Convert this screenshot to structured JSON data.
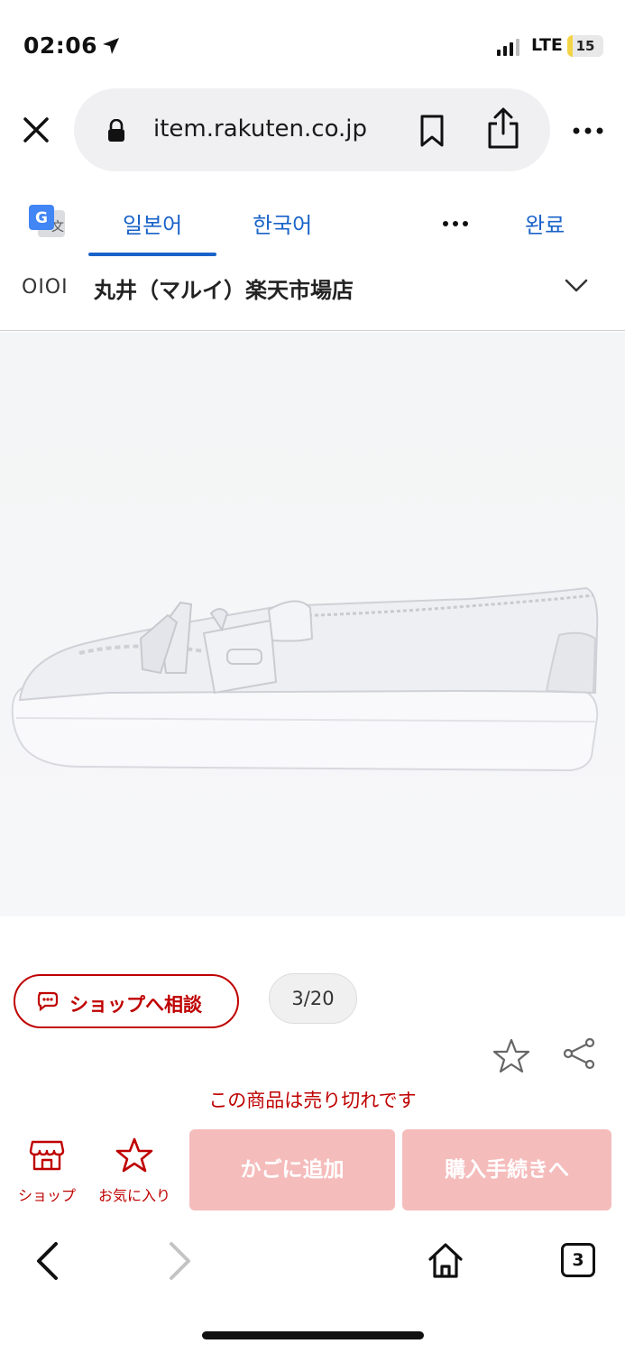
{
  "status_bar": {
    "time": "02:06",
    "network": "LTE",
    "battery": "15",
    "battery_level": 0.15
  },
  "browser": {
    "url": "item.rakuten.co.jp",
    "open_tabs": "3"
  },
  "translate_bar": {
    "tabs": [
      {
        "label": "일본어",
        "active": true
      },
      {
        "label": "한국어",
        "active": false
      }
    ],
    "done_label": "완료"
  },
  "site_header": {
    "logo": "OIOI",
    "shop_name": "丸井（マルイ）楽天市場店"
  },
  "product": {
    "image_icon": "white-leather-tassel-slip-on-shoe",
    "consult_label": "ショップへ相談",
    "image_counter": "3/20",
    "soldout_message": "この商品は売り切れです"
  },
  "action_bar": {
    "shop_label": "ショップ",
    "favorite_label": "お気に入り",
    "cart_label": "かごに追加",
    "buy_label": "購入手続きへ"
  },
  "colors": {
    "brand_red": "#bf0000",
    "disabled_button": "#f5bcbc",
    "link_blue": "#1a63c9"
  }
}
